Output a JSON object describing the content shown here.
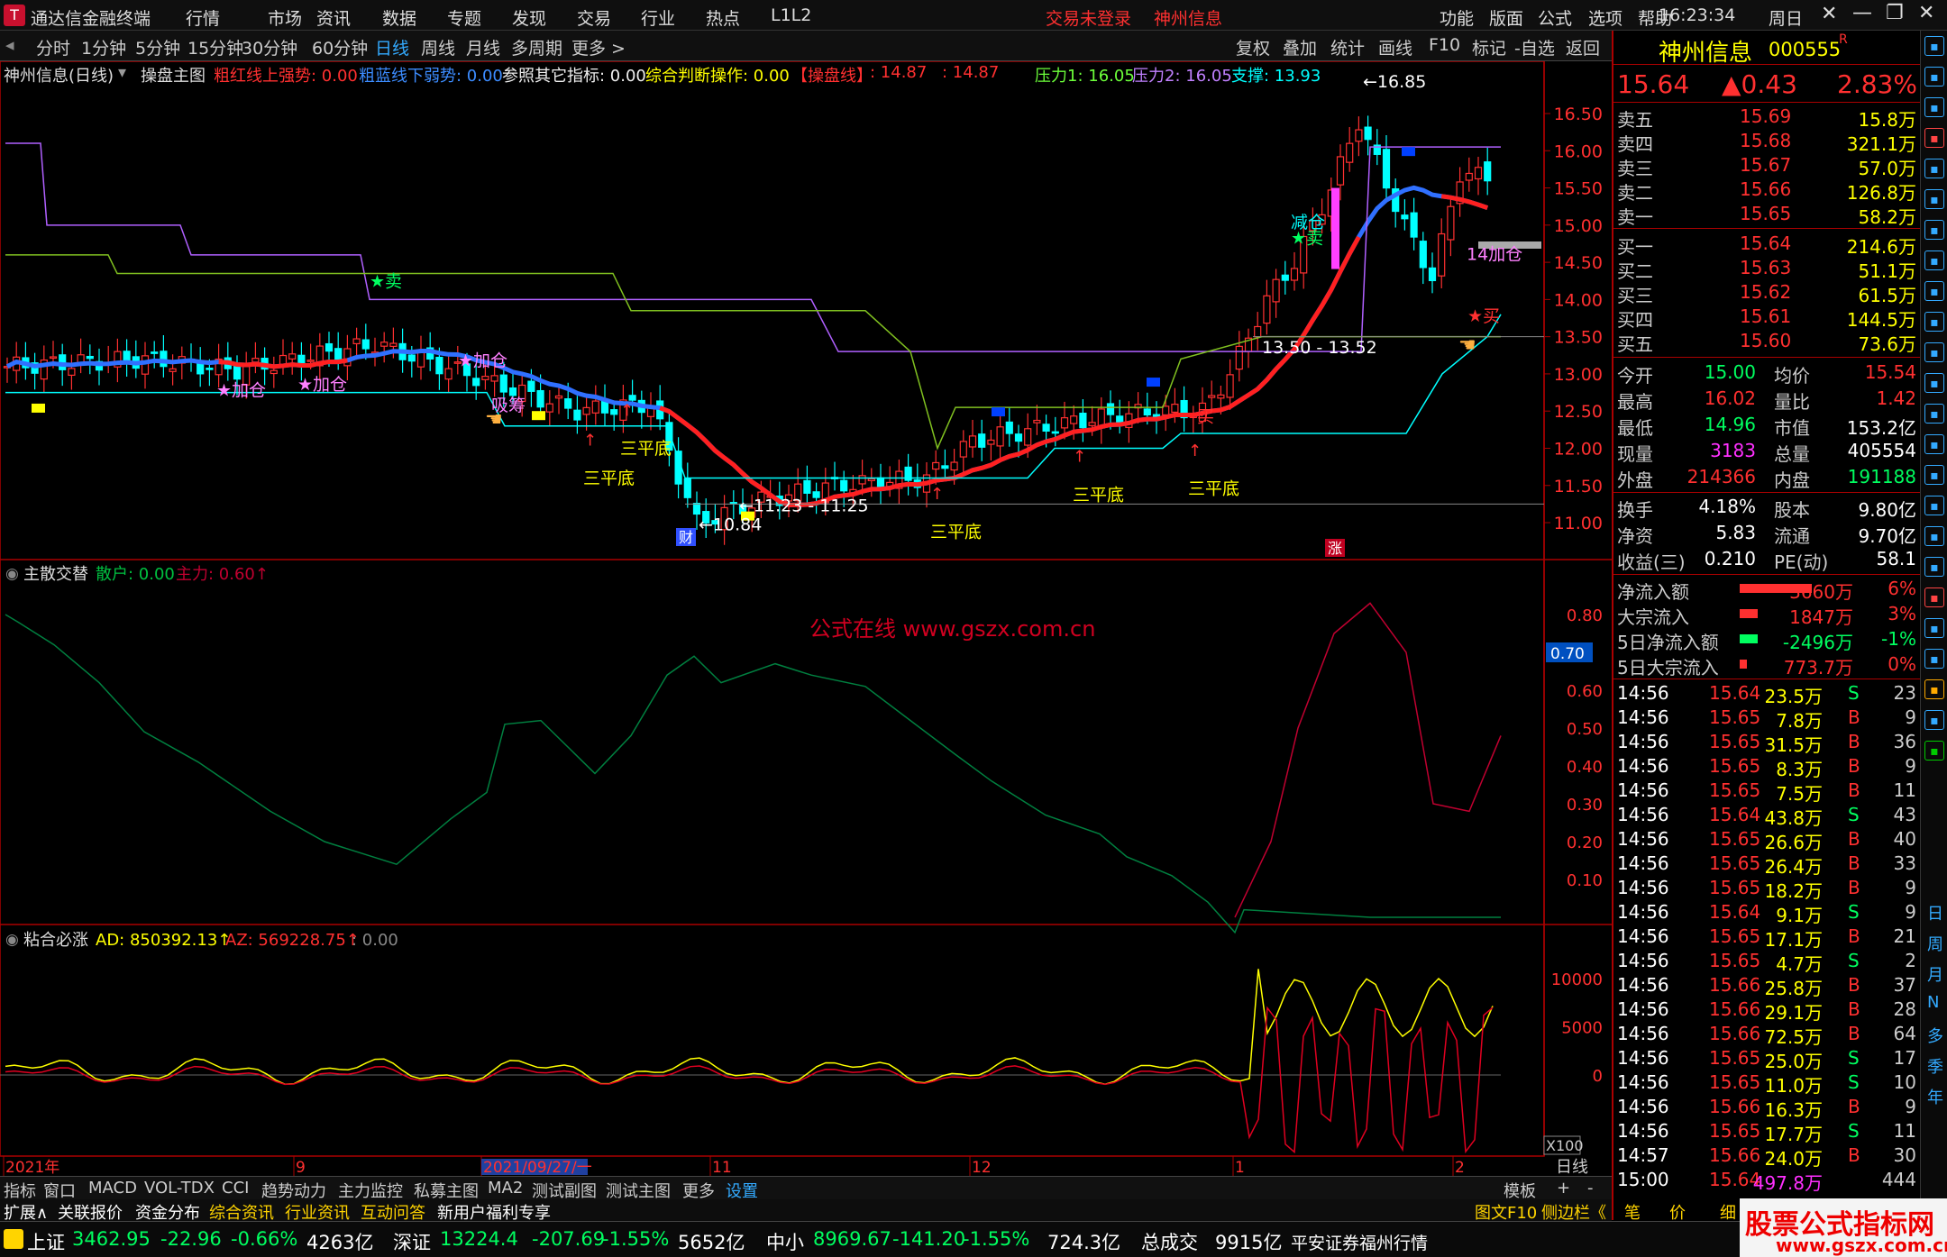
{
  "app": {
    "title": "通达信金融终端",
    "menus": [
      "行情",
      "市场",
      "资讯",
      "数据",
      "专题",
      "发现",
      "交易",
      "行业",
      "热点",
      "L1L2"
    ],
    "notice": "交易未登录",
    "notice_stock": "神州信息",
    "right_menus": [
      "功能",
      "版面",
      "公式",
      "选项",
      "帮助"
    ],
    "time": "16:23:34",
    "weekday": "周日"
  },
  "toolbar": {
    "periods": [
      "分时",
      "1分钟",
      "5分钟",
      "15分钟",
      "30分钟",
      "60分钟",
      "日线",
      "周线",
      "月线",
      "多周期",
      "更多 >"
    ],
    "active": "日线",
    "right": [
      "复权",
      "叠加",
      "统计",
      "画线",
      "F10",
      "标记",
      "-自选",
      "返回"
    ]
  },
  "info_line": {
    "stock": "神州信息(日线)",
    "formula": "操盘主图",
    "red": "粗红线上强势: 0.00",
    "blue": "粗蓝线下弱势: 0.00",
    "ref": "参照其它指标: 0.00",
    "judge": "综合判断操作: 0.00",
    "line_label": "【操盘线】",
    "v1": ": 14.87",
    "v2": ": 14.87",
    "p1": "压力1: 16.05",
    "p2": "压力2: 16.05",
    "support": "支撑: 13.93"
  },
  "main_axis": [
    "16.50",
    "16.00",
    "15.50",
    "15.00",
    "14.50",
    "14.00",
    "13.50",
    "13.00",
    "12.50",
    "12.00",
    "11.50",
    "11.00"
  ],
  "annotations": {
    "high": "16.85",
    "low": "10.84",
    "range1": "13.50 - 13.52",
    "range2": "11.23 - 11.25",
    "sanpingdi": "三平底",
    "jiacang": "加仓",
    "jiancang": "减仓",
    "mai": "卖",
    "mai_b": "买",
    "xishou": "吸筹",
    "cai": "财",
    "zhang": "涨",
    "sell_star": "★卖",
    "buy_star": "★买"
  },
  "sub1": {
    "title": "主散交替",
    "sanhu": "散户: 0.00",
    "zhuli": "主力: 0.60",
    "axis": [
      "0.80",
      "0.70",
      "0.60",
      "0.50",
      "0.40",
      "0.30",
      "0.20",
      "0.10"
    ],
    "current": "0.70",
    "watermark": "公式在线  www.gszx.com.cn"
  },
  "sub2": {
    "title": "粘合必涨",
    "ad": "AD: 850392.13",
    "az": "AZ: 569228.75",
    "extra": ": 0.00",
    "axis": [
      "10000",
      "5000",
      "0"
    ],
    "scale": "X100"
  },
  "xaxis": {
    "labels": [
      "2021年",
      "9",
      "2021/09/27/一",
      "11",
      "12",
      "1",
      "2"
    ],
    "period": "日线"
  },
  "quote": {
    "name": "神州信息",
    "code": "000555",
    "suffix": "R",
    "price": "15.64",
    "change": "▲0.43",
    "pct": "2.83%",
    "asks": [
      {
        "l": "卖五",
        "p": "15.69",
        "v": "15.8万"
      },
      {
        "l": "卖四",
        "p": "15.68",
        "v": "321.1万"
      },
      {
        "l": "卖三",
        "p": "15.67",
        "v": "57.0万"
      },
      {
        "l": "卖二",
        "p": "15.66",
        "v": "126.8万"
      },
      {
        "l": "卖一",
        "p": "15.65",
        "v": "58.2万"
      }
    ],
    "bids": [
      {
        "l": "买一",
        "p": "15.64",
        "v": "214.6万"
      },
      {
        "l": "买二",
        "p": "15.63",
        "v": "51.1万"
      },
      {
        "l": "买三",
        "p": "15.62",
        "v": "61.5万"
      },
      {
        "l": "买四",
        "p": "15.61",
        "v": "144.5万"
      },
      {
        "l": "买五",
        "p": "15.60",
        "v": "73.6万"
      }
    ],
    "stats": [
      [
        "今开",
        "15.00",
        "均价",
        "15.54"
      ],
      [
        "最高",
        "16.02",
        "量比",
        "1.42"
      ],
      [
        "最低",
        "14.96",
        "市值",
        "153.2亿"
      ],
      [
        "现量",
        "3183",
        "总量",
        "405554"
      ],
      [
        "外盘",
        "214366",
        "内盘",
        "191188"
      ]
    ],
    "stats2": [
      [
        "换手",
        "4.18%",
        "股本",
        "9.80亿"
      ],
      [
        "净资",
        "5.83",
        "流通",
        "9.70亿"
      ],
      [
        "收益(三)",
        "0.210",
        "PE(动)",
        "58.1"
      ]
    ],
    "flows": [
      {
        "l": "净流入额",
        "v": "3660万",
        "p": "6%"
      },
      {
        "l": "大宗流入",
        "v": "1847万",
        "p": "3%"
      },
      {
        "l": "5日净流入额",
        "v": "-2496万",
        "p": "-1%"
      },
      {
        "l": "5日大宗流入",
        "v": "773.7万",
        "p": "0%"
      }
    ],
    "ticks": [
      [
        "14:56",
        "15.64",
        "23.5万",
        "S",
        "23"
      ],
      [
        "14:56",
        "15.65",
        "7.8万",
        "B",
        "9"
      ],
      [
        "14:56",
        "15.65",
        "31.5万",
        "B",
        "36"
      ],
      [
        "14:56",
        "15.65",
        "8.3万",
        "B",
        "9"
      ],
      [
        "14:56",
        "15.65",
        "7.5万",
        "B",
        "11"
      ],
      [
        "14:56",
        "15.64",
        "43.8万",
        "S",
        "43"
      ],
      [
        "14:56",
        "15.65",
        "26.6万",
        "B",
        "40"
      ],
      [
        "14:56",
        "15.65",
        "26.4万",
        "B",
        "33"
      ],
      [
        "14:56",
        "15.65",
        "18.2万",
        "B",
        "9"
      ],
      [
        "14:56",
        "15.64",
        "9.1万",
        "S",
        "9"
      ],
      [
        "14:56",
        "15.65",
        "17.1万",
        "B",
        "21"
      ],
      [
        "14:56",
        "15.65",
        "4.7万",
        "S",
        "2"
      ],
      [
        "14:56",
        "15.66",
        "25.8万",
        "B",
        "37"
      ],
      [
        "14:56",
        "15.66",
        "29.1万",
        "B",
        "28"
      ],
      [
        "14:56",
        "15.66",
        "72.5万",
        "B",
        "64"
      ],
      [
        "14:56",
        "15.65",
        "25.0万",
        "S",
        "17"
      ],
      [
        "14:56",
        "15.65",
        "11.0万",
        "S",
        "10"
      ],
      [
        "14:56",
        "15.66",
        "16.3万",
        "B",
        "9"
      ],
      [
        "14:56",
        "15.65",
        "17.7万",
        "S",
        "11"
      ],
      [
        "14:57",
        "15.66",
        "24.0万",
        "B",
        "30"
      ],
      [
        "15:00",
        "15.64",
        "497.8万",
        "",
        "444"
      ]
    ]
  },
  "bottom_tabs": [
    "指标",
    "窗口",
    "MACD",
    "VOL-TDX",
    "CCI",
    "趋势动力",
    "主力监控",
    "私募主图",
    "MA2",
    "测试副图",
    "测试主图",
    "更多",
    "设置"
  ],
  "bottom_tabs2": [
    "扩展∧",
    "关联报价",
    "资金分布",
    "综合资讯",
    "行业资讯",
    "互动问答",
    "新用户福利专享"
  ],
  "bottom_right": [
    "模板",
    "+",
    "-"
  ],
  "bottom_right2": [
    "图文F10",
    "侧边栏《",
    "笔",
    "价",
    "细",
    "势"
  ],
  "status": {
    "sh": "上证",
    "sh_v": "3462.95",
    "sh_c": "-22.96",
    "sh_p": "-0.66%",
    "sh_a": "4263亿",
    "sz": "深证",
    "sz_v": "13224.4",
    "sz_c": "-207.69",
    "sz_p": "-1.55%",
    "sz_a": "5652亿",
    "zx": "中小",
    "zx_v": "8969.67",
    "zx_c": "-141.20",
    "zx_p": "-1.55%",
    "zx_a": "724.3亿",
    "zcj": "总成交",
    "zcj_v": "9915亿",
    "broker": "平安证券福州行情"
  },
  "watermark2": {
    "t1": "股票公式指标网",
    "t2": "www.gszx.com.cn"
  },
  "side_icons": [
    "up-arrow",
    "grid",
    "list",
    "chart",
    "text",
    "F10",
    "RSI",
    "gear"
  ],
  "side_labels": [
    "日",
    "周",
    "月",
    "N",
    "多",
    "季",
    "年"
  ],
  "colors": {
    "up": "#ff3030",
    "down": "#00ffff",
    "ma_red": "#ff2020",
    "ma_blue": "#3070ff",
    "yellow": "#ffff00"
  }
}
